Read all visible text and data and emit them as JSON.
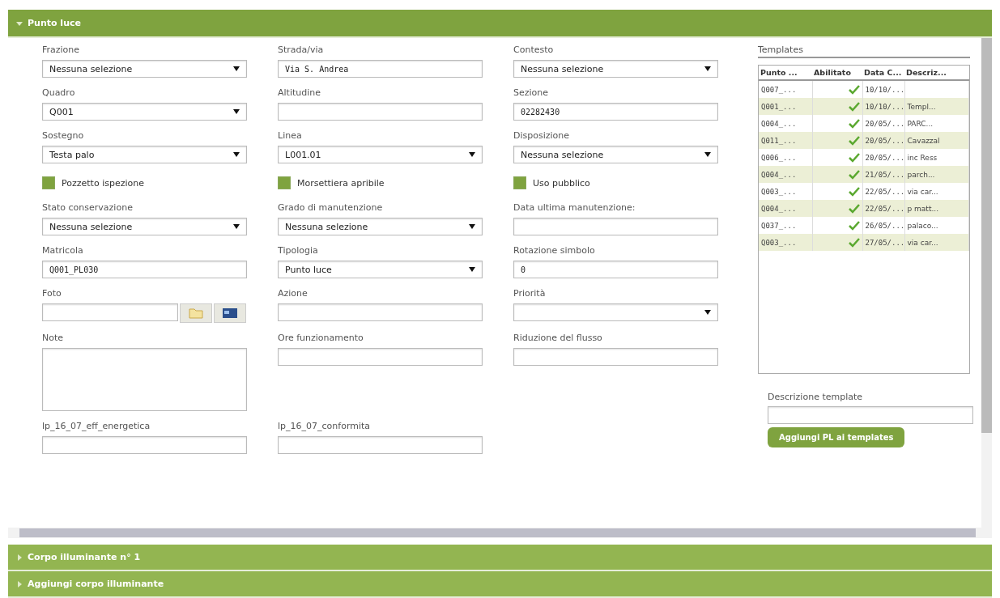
{
  "section": {
    "title": "Punto luce",
    "expanded": true
  },
  "form_rows": [
    [
      {
        "kind": "select",
        "label": "Frazione",
        "value": "Nessuna selezione"
      },
      {
        "kind": "text",
        "label": "Strada/via",
        "value": "Via S. Andrea"
      },
      {
        "kind": "select",
        "label": "Contesto",
        "value": "Nessuna selezione"
      }
    ],
    [
      {
        "kind": "select",
        "label": "Quadro",
        "value": "Q001"
      },
      {
        "kind": "text",
        "label": "Altitudine"
      },
      {
        "kind": "text",
        "label": "Sezione",
        "value": "02282430"
      }
    ],
    [
      {
        "kind": "select",
        "label": "Sostegno",
        "value": "Testa palo"
      },
      {
        "kind": "select",
        "label": "Linea",
        "value": "L001.01"
      },
      {
        "kind": "select",
        "label": "Disposizione",
        "value": "Nessuna selezione"
      }
    ],
    [
      {
        "kind": "checkbox",
        "label": "Pozzetto ispezione",
        "checked": true
      },
      {
        "kind": "checkbox",
        "label": "Morsettiera apribile",
        "checked": true
      },
      {
        "kind": "checkbox",
        "label": "Uso pubblico",
        "checked": true
      }
    ],
    [
      {
        "kind": "select",
        "label": "Stato conservazione",
        "value": "Nessuna selezione"
      },
      {
        "kind": "select",
        "label": "Grado di manutenzione",
        "value": "Nessuna selezione"
      },
      {
        "kind": "text",
        "label": "Data ultima manutenzione:"
      }
    ],
    [
      {
        "kind": "text",
        "label": "Matricola",
        "value": "Q001_PL030"
      },
      {
        "kind": "select",
        "label": "Tipologia",
        "value": "Punto luce"
      },
      {
        "kind": "text",
        "label": "Rotazione simbolo",
        "value": "0"
      }
    ],
    [
      {
        "kind": "file",
        "label": "Foto"
      },
      {
        "kind": "text",
        "label": "Azione"
      },
      {
        "kind": "select",
        "label": "Priorità"
      }
    ],
    [
      {
        "kind": "textarea",
        "label": "Note"
      },
      {
        "kind": "text",
        "label": "Ore funzionamento"
      },
      {
        "kind": "text",
        "label": "Riduzione del flusso"
      }
    ],
    [
      {
        "kind": "text",
        "label": "lp_16_07_eff_energetica"
      },
      {
        "kind": "text",
        "label": "lp_16_07_conformita"
      }
    ]
  ],
  "templates": {
    "title": "Templates",
    "columns": [
      "Punto ...",
      "Abilitato",
      "Data C...",
      "Descriz..."
    ],
    "rows": [
      {
        "code": "Q007_...",
        "enabled": true,
        "date": "10/10/..."
      },
      {
        "code": "Q001_...",
        "enabled": true,
        "date": "10/10/...",
        "description": "Templ..."
      },
      {
        "code": "Q004_...",
        "enabled": true,
        "date": "20/05/...",
        "description": "PARC..."
      },
      {
        "code": "Q011_...",
        "enabled": true,
        "date": "20/05/...",
        "description": "Cavazzal"
      },
      {
        "code": "Q006_...",
        "enabled": true,
        "date": "20/05/...",
        "description": "inc Ress"
      },
      {
        "code": "Q004_...",
        "enabled": true,
        "date": "21/05/...",
        "description": "parch..."
      },
      {
        "code": "Q003_...",
        "enabled": true,
        "date": "22/05/...",
        "description": "via car..."
      },
      {
        "code": "Q004_...",
        "enabled": true,
        "date": "22/05/...",
        "description": "p matt..."
      },
      {
        "code": "Q037_...",
        "enabled": true,
        "date": "26/05/...",
        "description": "palaco..."
      },
      {
        "code": "Q003_...",
        "enabled": true,
        "date": "27/05/...",
        "description": "via car..."
      }
    ],
    "description_label": "Descrizione template",
    "add_button": "Aggiungi PL ai templates"
  },
  "collapsed_sections": [
    {
      "title": "Corpo illuminante n° 1",
      "expanded": false
    },
    {
      "title": "Aggiungi corpo illuminante",
      "expanded": false
    }
  ]
}
